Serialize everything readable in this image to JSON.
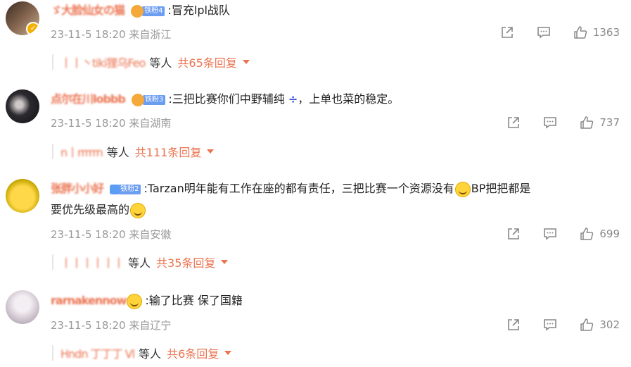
{
  "comments": [
    {
      "username": "ゞ大脸仙女の猫",
      "badge_label": "铁粉4",
      "text": ":冒充lpl战队",
      "date": "23-11-5 18:20",
      "location": "来自浙江",
      "likes": "1363",
      "reply_names": "丨丨丶tiki狸乌Feo",
      "reply_deng": "等人",
      "reply_count": "共65条回复"
    },
    {
      "username": "点尔在川lobbb",
      "badge_label": "铁粉3",
      "text_a": ":三把比赛你们中野辅纯",
      "text_b": "，上单也菜的稳定。",
      "date": "23-11-5 18:20",
      "location": "来自湖南",
      "likes": "737",
      "reply_names": "n丨rrrrrn",
      "reply_deng": "等人",
      "reply_count": "共111条回复"
    },
    {
      "username": "张胖小小好",
      "badge_label": "铁粉2",
      "text_a": ":Tarzan明年能有工作在座的都有责任，三把比赛一个资源没有",
      "text_b": "BP把把都是",
      "text_c": "要优先级最高的",
      "date": "23-11-5 18:20",
      "location": "来自安徽",
      "likes": "699",
      "reply_names": "丨丨丨丨丨丨",
      "reply_deng": "等人",
      "reply_count": "共35条回复"
    },
    {
      "username": "rarnakennow",
      "text": ":输了比赛 保了国籍",
      "date": "23-11-5 18:20",
      "location": "来自辽宁",
      "likes": "302",
      "reply_names": "Hndn 丁丁丁 Vl",
      "reply_deng": "等人",
      "reply_count": "共6条回复"
    }
  ]
}
